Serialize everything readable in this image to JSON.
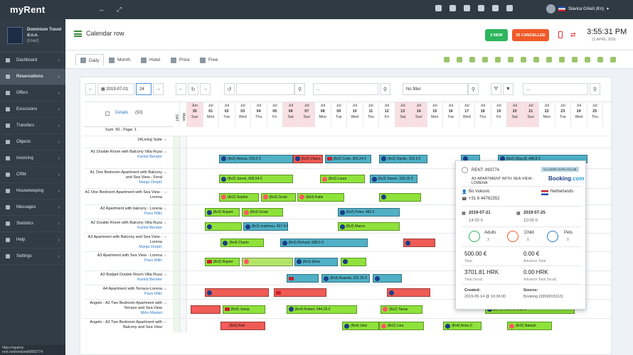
{
  "app": {
    "logo": "myRent",
    "user_name": "Slavica Grkeš (Kn)",
    "status_url": "https://appmy-rent.net/rents/edit/893774"
  },
  "company": {
    "name_line1": "Dominium Travel",
    "name_line2": "d.o.o.",
    "role": "(User)"
  },
  "sidebar": {
    "items": [
      {
        "label": "Dashboard",
        "icon": "dashboard-icon"
      },
      {
        "label": "Reservations",
        "icon": "calendar-icon",
        "active": true
      },
      {
        "label": "Offers",
        "icon": "tag-icon"
      },
      {
        "label": "Excursions",
        "icon": "map-icon"
      },
      {
        "label": "Transfers",
        "icon": "car-icon"
      },
      {
        "label": "Objects",
        "icon": "building-icon"
      },
      {
        "label": "Invoicing",
        "icon": "invoice-icon"
      },
      {
        "label": "CRM",
        "icon": "people-icon"
      },
      {
        "label": "Housekeeping",
        "icon": "broom-icon"
      },
      {
        "label": "Messages",
        "icon": "mail-icon"
      },
      {
        "label": "Statistics",
        "icon": "chart-icon"
      },
      {
        "label": "Help",
        "icon": "help-icon"
      },
      {
        "label": "Settings",
        "icon": "gear-icon"
      }
    ]
  },
  "header": {
    "title": "Calendar row",
    "btn_new": "3 NEW",
    "btn_cancel": "25 CANCELLED",
    "time": "3:55:31 PM",
    "date": "22 APRIL 2020"
  },
  "tabs": [
    {
      "label": "Daily",
      "active": true
    },
    {
      "label": "Month"
    },
    {
      "label": "Hotel"
    },
    {
      "label": "Price"
    },
    {
      "label": "Free"
    }
  ],
  "controls": {
    "date_value": "2019-07-01",
    "days_value": "24",
    "search_placeholder": "",
    "select1": "...",
    "filter": "No filter",
    "select2": "..."
  },
  "grid_header": {
    "details": "Details",
    "count": "(50)",
    "sat": "SAT",
    "main": "Main.",
    "sum": "Sum: 50 , Page: 1"
  },
  "days": [
    {
      "m": "Jun",
      "d": "30",
      "w": "Sun",
      "t": "we"
    },
    {
      "m": "Jul",
      "d": "01",
      "w": "Mon"
    },
    {
      "m": "Jul",
      "d": "02",
      "w": "Tue"
    },
    {
      "m": "Jul",
      "d": "03",
      "w": "Wed"
    },
    {
      "m": "Jul",
      "d": "04",
      "w": "Thu"
    },
    {
      "m": "Jul",
      "d": "05",
      "w": "Fri"
    },
    {
      "m": "Jul",
      "d": "06",
      "w": "Sat",
      "t": "we"
    },
    {
      "m": "Jul",
      "d": "07",
      "w": "Sun",
      "t": "we"
    },
    {
      "m": "Jul",
      "d": "08",
      "w": "Mon"
    },
    {
      "m": "Jul",
      "d": "09",
      "w": "Tue"
    },
    {
      "m": "Jul",
      "d": "10",
      "w": "Wed"
    },
    {
      "m": "Jul",
      "d": "11",
      "w": "Thu"
    },
    {
      "m": "Jul",
      "d": "12",
      "w": "Fri"
    },
    {
      "m": "Jul",
      "d": "13",
      "w": "Sat",
      "t": "we"
    },
    {
      "m": "Jul",
      "d": "14",
      "w": "Sun",
      "t": "we"
    },
    {
      "m": "Jul",
      "d": "15",
      "w": "Mon"
    },
    {
      "m": "Jul",
      "d": "16",
      "w": "Tue"
    },
    {
      "m": "Jul",
      "d": "17",
      "w": "Wed"
    },
    {
      "m": "Jul",
      "d": "18",
      "w": "Thu"
    },
    {
      "m": "Jul",
      "d": "19",
      "w": "Fri"
    },
    {
      "m": "Jul",
      "d": "20",
      "w": "Sat",
      "t": "we"
    },
    {
      "m": "Jul",
      "d": "21",
      "w": "Sun",
      "t": "we"
    },
    {
      "m": "Jul",
      "d": "22",
      "w": "Mon"
    },
    {
      "m": "Jul",
      "d": "23",
      "w": "Tue"
    },
    {
      "m": "Jul",
      "d": "24",
      "w": "Wed"
    },
    {
      "m": "Jul",
      "d": "25",
      "w": "Thu"
    }
  ],
  "rows": [
    {
      "name": "24Living Suite",
      "mgr": "",
      "h": 17,
      "bars": []
    },
    {
      "name": "A1 Double Room with Balcony Villa Ruza",
      "mgr": "Karloti Bender",
      "h": 29,
      "bars": [
        {
          "c": 2,
          "len": 4.6,
          "color": "teal",
          "icon": "bk",
          "text": "(8x2) Alessa, 553.5 €"
        },
        {
          "c": 6.6,
          "len": 1.9,
          "color": "red",
          "icon": "bk",
          "text": "(6x3) Vlasni, 0"
        },
        {
          "c": 8.6,
          "len": 2.9,
          "color": "teal",
          "icon": "fl",
          "text": "(8x2) Cristi, 300.24 €"
        },
        {
          "c": 12,
          "len": 3,
          "color": "teal",
          "icon": "bk",
          "text": "(8x2) Danilo, 315.9 €"
        },
        {
          "c": 17.1,
          "len": 1.2,
          "color": "teal",
          "icon": "bk",
          "text": ""
        },
        {
          "c": 19.4,
          "len": 5.6,
          "color": "teal",
          "icon": "bk",
          "text": "(8x2) Oleg M, 490.8 €"
        }
      ]
    },
    {
      "name": "A1 One Bedroom Apartment with Balcony and Sea View - Feral",
      "mgr": "Marija Orepić",
      "h": 28,
      "bars": [
        {
          "c": 2,
          "len": 4.6,
          "color": "green",
          "icon": "bk",
          "text": "(8x2) Jaroni, 606.54 €"
        },
        {
          "c": 8.3,
          "len": 2.8,
          "color": "green",
          "icon": "ar",
          "text": "(8x2) Laura"
        },
        {
          "c": 11.4,
          "len": 3,
          "color": "teal",
          "icon": "bk",
          "text": "(8x3) Saveri, 333.25 €"
        }
      ]
    },
    {
      "name": "A1 One Bedroom Apartment with Sea View - Lorena",
      "mgr": "",
      "h": 23,
      "bars": [
        {
          "c": 2,
          "len": 2.5,
          "color": "green",
          "icon": "ar",
          "text": "(8x2) Sophie"
        },
        {
          "c": 4.6,
          "len": 2.2,
          "color": "green",
          "icon": "ar",
          "text": "(8x3) Grant"
        },
        {
          "c": 6.9,
          "len": 2.9,
          "color": "green",
          "icon": "ar",
          "text": "(8x3) Katie"
        },
        {
          "c": 12,
          "len": 2.6,
          "color": "green",
          "icon": "bk",
          "text": ""
        }
      ]
    },
    {
      "name": "A2 Apartment with balcony - Lorena",
      "mgr": "Pavo Milić",
      "h": 20,
      "bars": [
        {
          "c": 1.1,
          "len": 2.2,
          "color": "green",
          "icon": "bk",
          "text": "(8x2) Rupert"
        },
        {
          "c": 3.4,
          "len": 2.6,
          "color": "green",
          "icon": "ar",
          "text": "(8x3) Grant"
        },
        {
          "c": 9.4,
          "len": 3.9,
          "color": "teal",
          "icon": "bk",
          "text": "(8x2) Peter, 483 €"
        }
      ]
    },
    {
      "name": "A2 Double Room with Balcony Villa Ruza",
      "mgr": "Karloti Bender",
      "h": 20,
      "bars": [
        {
          "c": 1.1,
          "len": 2.3,
          "color": "green",
          "icon": "bk",
          "text": ""
        },
        {
          "c": 3.5,
          "len": 2.8,
          "color": "teal",
          "icon": "bk",
          "text": "(8x2) mahmou, 437.4 €"
        },
        {
          "c": 9.4,
          "len": 3.9,
          "color": "green",
          "icon": "bk",
          "text": "(8x2) Marco"
        }
      ]
    },
    {
      "name": "A3 Apartment with Balcony and Sea View - Lorena",
      "mgr": "Marija Orepić",
      "h": 26,
      "bars": [
        {
          "c": 2.1,
          "len": 2.7,
          "color": "green",
          "icon": "bk",
          "text": "(8x4) Charlo"
        },
        {
          "c": 5.8,
          "len": 5.5,
          "color": "teal",
          "icon": "bk",
          "text": "(8x4) Richard, 688.5 €"
        },
        {
          "c": 13.5,
          "len": 2,
          "color": "red",
          "icon": "bk",
          "text": ""
        },
        {
          "c": 23,
          "len": 1.8,
          "color": "red",
          "icon": "bk",
          "text": ""
        }
      ]
    },
    {
      "name": "A3 Apartment with Sea View - Lorena",
      "mgr": "Pavo Milić",
      "h": 27,
      "bars": [
        {
          "c": 1.1,
          "len": 2.2,
          "color": "green",
          "icon": "fl",
          "text": "(8x2) Rupert"
        },
        {
          "c": 3.4,
          "len": 3.2,
          "color": "lime",
          "icon": "ar",
          "text": ""
        },
        {
          "c": 6.7,
          "len": 2.7,
          "color": "teal",
          "icon": "bk",
          "text": "(8x3) Elma"
        },
        {
          "c": 9.6,
          "len": 1.6,
          "color": "green",
          "icon": "bk",
          "text": ""
        }
      ]
    },
    {
      "name": "A3 Budget Double Room Villa Ruza",
      "mgr": "Karloti Bender",
      "h": 20,
      "bars": [
        {
          "c": 6.2,
          "len": 2,
          "color": "teal",
          "icon": "fl",
          "text": ""
        },
        {
          "c": 8.4,
          "len": 3,
          "color": "teal",
          "icon": "bk",
          "text": "(8x3) Ananda, 331.25 €"
        },
        {
          "c": 11.6,
          "len": 1.8,
          "color": "teal",
          "icon": "bk",
          "text": ""
        }
      ]
    },
    {
      "name": "A4 Apartment with Terrace-Lorena",
      "mgr": "Pavo Milić",
      "h": 20,
      "bars": [
        {
          "c": 1.1,
          "len": 4,
          "color": "red",
          "icon": "bk",
          "text": ""
        },
        {
          "c": 5.4,
          "len": 3.3,
          "color": "red",
          "icon": "fl",
          "text": ""
        },
        {
          "c": 12.5,
          "len": 2.7,
          "color": "red",
          "icon": "bk",
          "text": ""
        },
        {
          "c": 19.2,
          "len": 3.4,
          "color": "red",
          "icon": "bk",
          "text": "(8x2) glovan, 666.5 €"
        }
      ]
    },
    {
      "name": "Angelo - A2 Two Bedroom Apartment with Terrace and Sea View",
      "mgr": "Miho Market",
      "h": 27,
      "bars": [
        {
          "c": 0.2,
          "len": 1.9,
          "color": "red",
          "icon": "ar",
          "text": ""
        },
        {
          "c": 2.2,
          "len": 2.7,
          "color": "green",
          "icon": "fl",
          "text": "(8x5) Josep"
        },
        {
          "c": 6.2,
          "len": 4.4,
          "color": "green",
          "icon": "bk",
          "text": "(8x4) Robert, 644.25 €"
        },
        {
          "c": 12.1,
          "len": 2.6,
          "color": "green",
          "icon": "ar",
          "text": "(8x2) Tanas"
        },
        {
          "c": 18.6,
          "len": 5.6,
          "color": "green",
          "icon": "bk",
          "text": "(8x4) Peter, 973.33 €"
        }
      ]
    },
    {
      "name": "Angelo - A3 Two Bedroom Apartment with Balcony and Sea View",
      "mgr": "",
      "h": 20,
      "bars": [
        {
          "c": 2.1,
          "len": 2.8,
          "color": "red",
          "icon": "ar",
          "text": "(8x5) Rob"
        },
        {
          "c": 9.7,
          "len": 2.3,
          "color": "green",
          "icon": "bk",
          "text": "(8x4) Julie"
        },
        {
          "c": 12,
          "len": 2.8,
          "color": "green",
          "icon": "ar",
          "text": "(8x2) Lina"
        },
        {
          "c": 16,
          "len": 2.4,
          "color": "green",
          "icon": "bk",
          "text": "(8x4) Anne-C"
        },
        {
          "c": 20,
          "len": 2.8,
          "color": "green",
          "icon": "ar",
          "text": "(8x5) Natash"
        }
      ]
    }
  ],
  "popup": {
    "rent_label": "RENT: 893774",
    "badge": "VLASNIK NAPLAĆUJE",
    "apartment": "A3 APARTMENT WITH SEA VIEW - LORENA",
    "booking_logo_1": "Booking",
    "booking_logo_2": ".com",
    "guest": "Bo Vukovic",
    "phone": "+31 6 44762352",
    "country": "Netherlands",
    "date_from": "2019-07-21",
    "date_to": "2019-07-25",
    "time_from": "14:00 h",
    "time_to": "10:00 h",
    "adults_label": "Adults",
    "adults_val": "3",
    "child_label": "Child",
    "child_val": "0",
    "pets_label": "Pets",
    "pets_val": "0",
    "total_eur": "500.00 €",
    "total_eur_label": "Total",
    "advance_eur": "0.00 €",
    "advance_eur_label": "Advance Total",
    "total_local": "3701.81 HRK",
    "total_local_label": "Total (local)",
    "advance_local": "0.00 HRK",
    "advance_local_label": "Advance Total (local)",
    "created_label": "Created:",
    "created_val": "2019-05-14 @ 10:36:00",
    "source_label": "Source:",
    "source_val": "Booking (3359915313)"
  },
  "colors": {
    "sidebar": "#313c46",
    "green": "#8ee23a",
    "teal": "#4fb0c6",
    "red": "#ef5b55",
    "new": "#2db55d",
    "cancel": "#f05a28"
  }
}
